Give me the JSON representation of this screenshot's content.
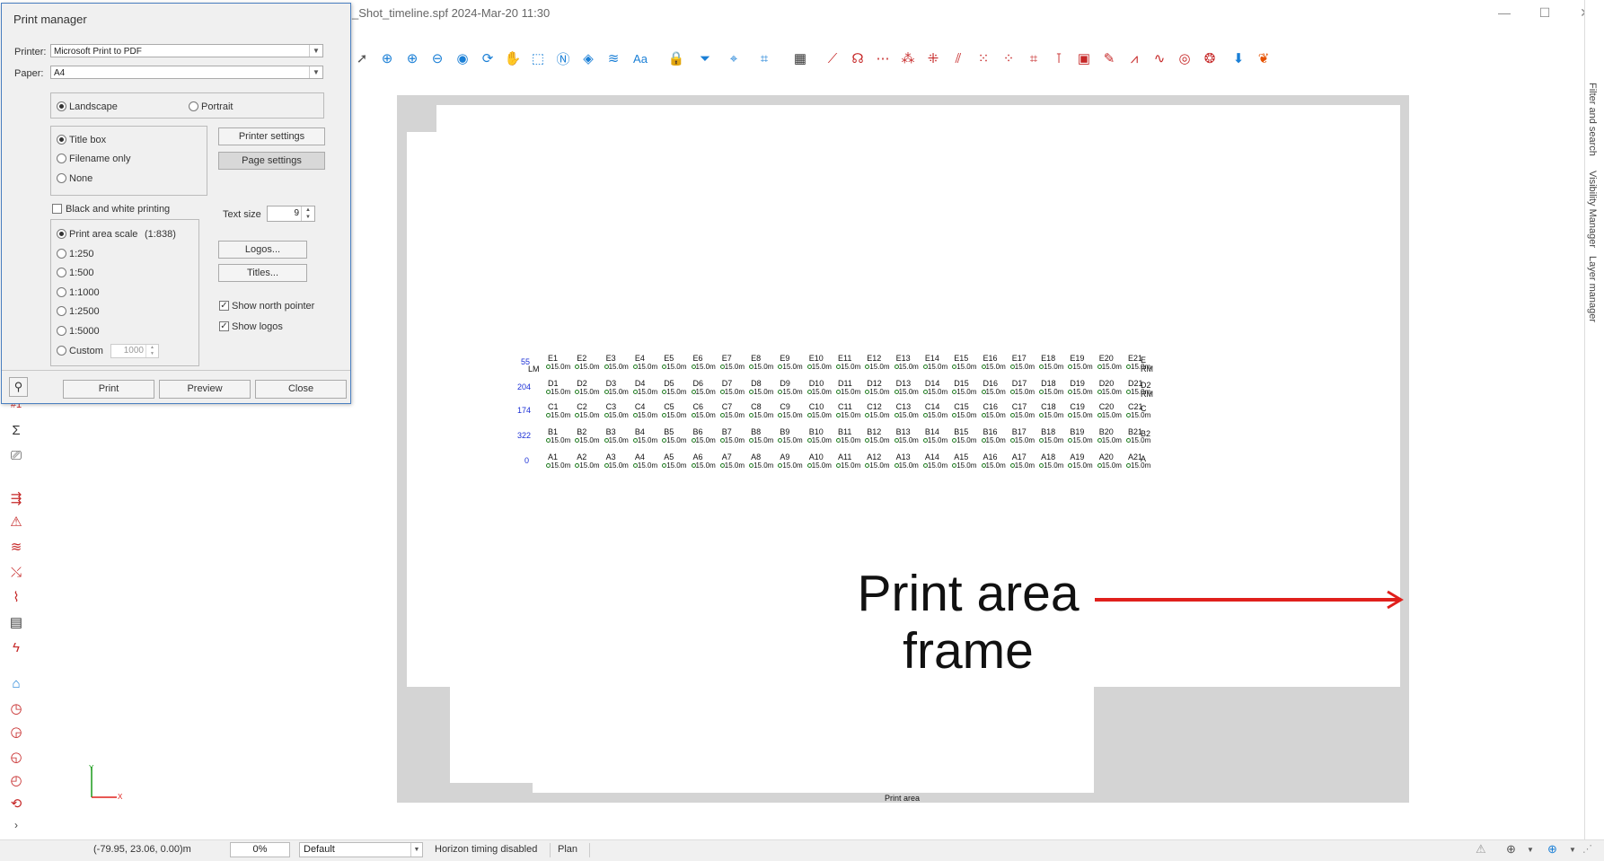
{
  "window": {
    "title": "_Shot_timeline.spf 2024-Mar-20 11:30",
    "min": "—",
    "max": "☐",
    "close": "✕"
  },
  "dialog": {
    "title": "Print manager",
    "printer_label": "Printer:",
    "printer_value": "Microsoft Print to PDF",
    "paper_label": "Paper:",
    "paper_value": "A4",
    "orientation": {
      "landscape": "Landscape",
      "portrait": "Portrait",
      "selected": "landscape"
    },
    "title_options": {
      "title_box": "Title box",
      "filename_only": "Filename only",
      "none": "None",
      "selected": "title_box"
    },
    "printer_settings": "Printer settings",
    "page_settings": "Page settings",
    "bw_printing": "Black and white printing",
    "bw_checked": false,
    "text_size_label": "Text size",
    "text_size_value": "9",
    "scale": {
      "print_area_scale": "Print area scale",
      "print_area_ratio": "(1:838)",
      "s250": "1:250",
      "s500": "1:500",
      "s1000": "1:1000",
      "s2500": "1:2500",
      "s5000": "1:5000",
      "custom": "Custom",
      "custom_value": "1000",
      "selected": "print_area_scale"
    },
    "logos_button": "Logos...",
    "titles_button": "Titles...",
    "show_north": "Show north pointer",
    "show_north_checked": true,
    "show_logos": "Show logos",
    "show_logos_checked": true,
    "print_button": "Print",
    "preview_button": "Preview",
    "close_button": "Close"
  },
  "side_tabs": [
    "Filter and search",
    "Visibility Manager",
    "Layer manager"
  ],
  "canvas": {
    "annotation_line1": "Print area",
    "annotation_line2": "frame",
    "print_area_label": "Print area",
    "axis_y": "Y",
    "axis_x": "X"
  },
  "plan": {
    "rows": [
      {
        "prefix": "E",
        "left_number": "55",
        "left_code": "LM",
        "right_label": "E",
        "right_label2": "RM"
      },
      {
        "prefix": "D",
        "left_number": "204",
        "left_code": "",
        "right_label": "D2",
        "right_label2": "RM"
      },
      {
        "prefix": "C",
        "left_number": "174",
        "left_code": "",
        "right_label": "C",
        "right_label2": ""
      },
      {
        "prefix": "B",
        "left_number": "322",
        "left_code": "",
        "right_label": "B2",
        "right_label2": ""
      },
      {
        "prefix": "A",
        "left_number": "0",
        "left_code": "",
        "right_label": "A",
        "right_label2": ""
      }
    ],
    "hole_depth": "15.0m",
    "count": 21
  },
  "statusbar": {
    "coords": "(-79.95, 23.06, 0.00)m",
    "percent": "0%",
    "layer": "Default",
    "horizon": "Horizon timing disabled",
    "view": "Plan"
  },
  "colors": {
    "accent": "#4a7fc0",
    "annotation_arrow": "#e0201c",
    "plan_number": "#1b2fd6"
  }
}
